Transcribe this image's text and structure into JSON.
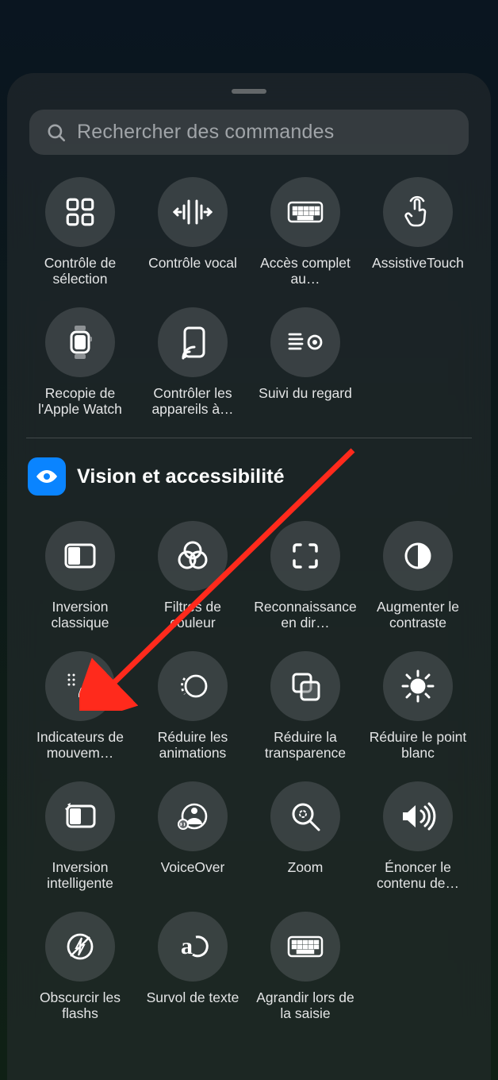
{
  "search": {
    "placeholder": "Rechercher des commandes"
  },
  "section1": {
    "items": [
      {
        "label": "Contrôle de sélection"
      },
      {
        "label": "Contrôle vocal"
      },
      {
        "label": "Accès complet au…"
      },
      {
        "label": "AssistiveTouch"
      },
      {
        "label": "Recopie de l'Apple Watch"
      },
      {
        "label": "Contrôler les appareils à…"
      },
      {
        "label": "Suivi du regard"
      }
    ]
  },
  "section2": {
    "title": "Vision et accessibilité",
    "items": [
      {
        "label": "Inversion classique"
      },
      {
        "label": "Filtres de couleur"
      },
      {
        "label": "Reconnaissance en dir…"
      },
      {
        "label": "Augmenter le contraste"
      },
      {
        "label": "Indicateurs de mouvem…"
      },
      {
        "label": "Réduire les animations"
      },
      {
        "label": "Réduire la transparence"
      },
      {
        "label": "Réduire le point blanc"
      },
      {
        "label": "Inversion intelligente"
      },
      {
        "label": "VoiceOver"
      },
      {
        "label": "Zoom"
      },
      {
        "label": "Énoncer le contenu de…"
      },
      {
        "label": "Obscurcir les flashs"
      },
      {
        "label": "Survol de texte"
      },
      {
        "label": "Agrandir lors de la saisie"
      }
    ]
  },
  "annotation": {
    "arrow_color": "#ff2a1c"
  }
}
